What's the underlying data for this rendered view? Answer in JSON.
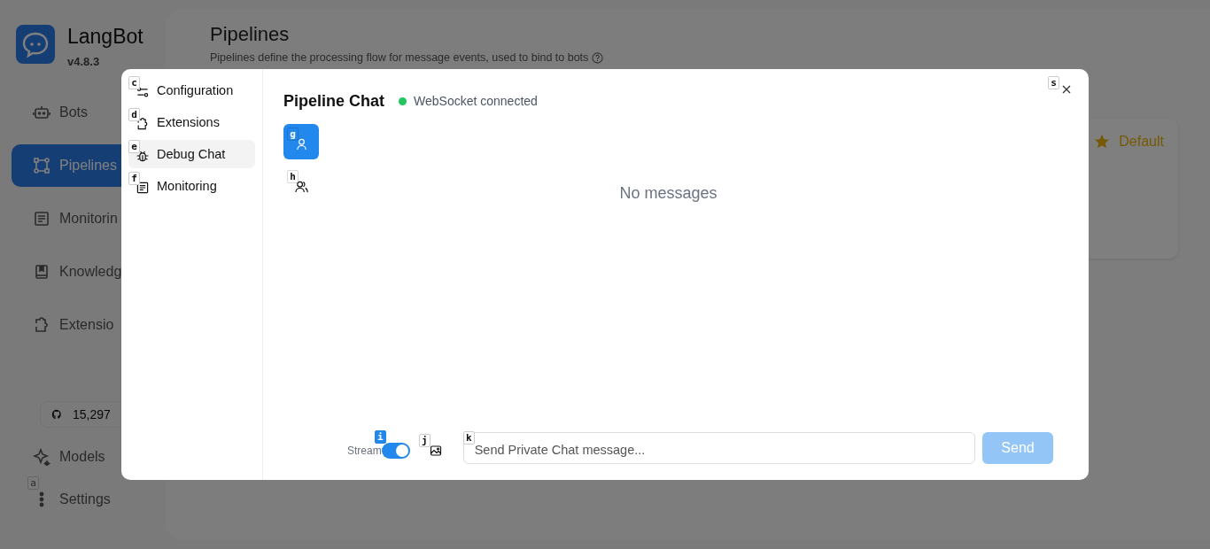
{
  "app": {
    "name": "LangBot",
    "version": "v4.8.3"
  },
  "sidebar": {
    "items": [
      {
        "label": "Bots",
        "kind": "bot",
        "selected": false
      },
      {
        "label": "Pipelines",
        "kind": "pipeline",
        "selected": true
      },
      {
        "label": "Monitorin",
        "kind": "monitor",
        "selected": false
      },
      {
        "label": "Knowledg",
        "kind": "book",
        "selected": false
      },
      {
        "label": "Extensio",
        "kind": "puzzle",
        "selected": false
      }
    ],
    "stars_badge": {
      "count": "15,297"
    },
    "bottom_items": [
      {
        "label": "Models",
        "kind": "sparkle"
      },
      {
        "label": "Settings",
        "kind": "dots",
        "hint": "a"
      }
    ]
  },
  "page": {
    "title": "Pipelines",
    "subtitle": "Pipelines define the processing flow for message events, used to bind to bots",
    "card": {
      "badge": "Default"
    }
  },
  "dialog": {
    "nav": [
      {
        "label": "Configuration",
        "kind": "sliders",
        "hint": "c",
        "selected": false
      },
      {
        "label": "Extensions",
        "kind": "puzzle",
        "hint": "d",
        "selected": false
      },
      {
        "label": "Debug Chat",
        "kind": "bug",
        "hint": "e",
        "selected": true
      },
      {
        "label": "Monitoring",
        "kind": "monitor",
        "hint": "f",
        "selected": false
      }
    ],
    "title": "Pipeline Chat",
    "status": {
      "text": "WebSocket connected",
      "connected": true
    },
    "chat_types": [
      {
        "kind": "private",
        "hint": "g",
        "selected": true
      },
      {
        "kind": "group",
        "hint": "h",
        "selected": false
      }
    ],
    "empty_text": "No messages",
    "stream": {
      "label": "Stream",
      "on": true,
      "hint": "i"
    },
    "image_hint": "j",
    "input": {
      "placeholder": "Send Private Chat message...",
      "hint": "k"
    },
    "send": {
      "label": "Send",
      "disabled": true
    },
    "close_hint": "s"
  }
}
